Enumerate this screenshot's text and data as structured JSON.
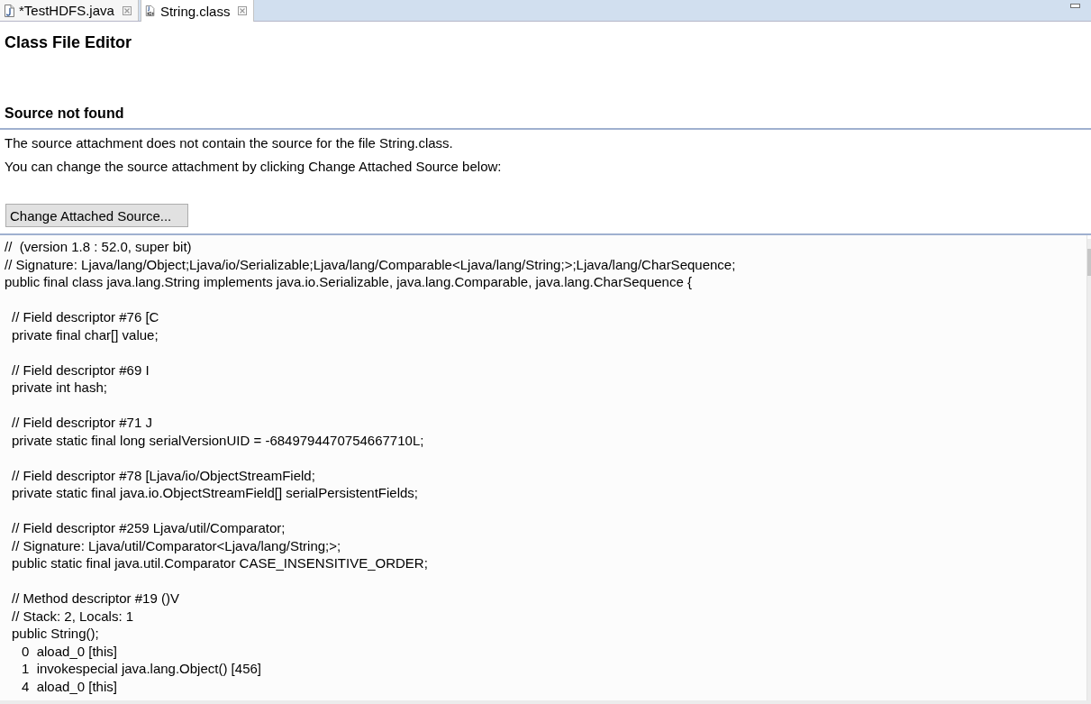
{
  "tabs": [
    {
      "label": "*TestHDFS.java",
      "kind": "java",
      "selected": false
    },
    {
      "label": "String.class",
      "kind": "class",
      "selected": true
    }
  ],
  "editor": {
    "title": "Class File Editor",
    "section_title": "Source not found",
    "messages": [
      "The source attachment does not contain the source for the file String.class.",
      "You can change the source attachment by clicking Change Attached Source below:"
    ],
    "button": "Change Attached Source..."
  },
  "code": {
    "header": [
      "//  (version 1.8 : 52.0, super bit)",
      "// Signature: Ljava/lang/Object;Ljava/io/Serializable;Ljava/lang/Comparable<Ljava/lang/String;>;Ljava/lang/CharSequence;",
      "public final class java.lang.String implements java.io.Serializable, java.lang.Comparable, java.lang.CharSequence {"
    ],
    "members": [
      {
        "lines": [
          "// Field descriptor #76 [C",
          "private final char[] value;"
        ]
      },
      {
        "lines": [
          "// Field descriptor #69 I",
          "private int hash;"
        ]
      },
      {
        "lines": [
          "// Field descriptor #71 J",
          "private static final long serialVersionUID = -6849794470754667710L;"
        ]
      },
      {
        "lines": [
          "// Field descriptor #78 [Ljava/io/ObjectStreamField;",
          "private static final java.io.ObjectStreamField[] serialPersistentFields;"
        ]
      },
      {
        "lines": [
          "// Field descriptor #259 Ljava/util/Comparator;",
          "// Signature: Ljava/util/Comparator<Ljava/lang/String;>;",
          "public static final java.util.Comparator CASE_INSENSITIVE_ORDER;"
        ]
      },
      {
        "lines": [
          "// Method descriptor #19 ()V",
          "// Stack: 2, Locals: 1",
          "public String();"
        ],
        "instructions": [
          "0  aload_0 [this]",
          "1  invokespecial java.lang.Object() [456]",
          "4  aload_0 [this]"
        ]
      }
    ]
  }
}
